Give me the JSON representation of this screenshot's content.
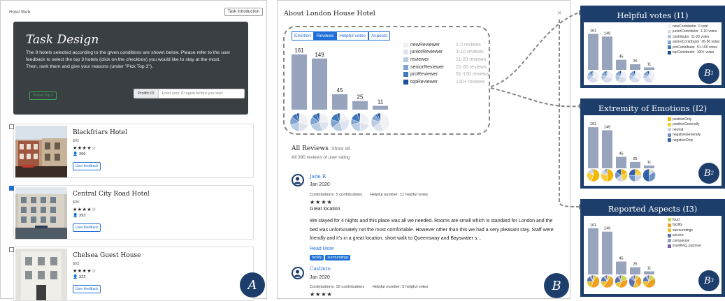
{
  "panel_a": {
    "brand": "Hotel Web",
    "task_intro_button": "Task Introduction",
    "task_title": "Task Design",
    "task_text_1": "The 9 hotels selected according to the given conditions are shown below. Please refer to the user feedback to select the top 3 hotels (click on the checkbox) you would like to stay at the most.",
    "task_text_2": "Then, rank them and give your reasons (under \"Pick Top 3\").",
    "picked_button": "Picked Top 3",
    "prolific_label": "Prolific ID",
    "prolific_placeholder": "Enter your ID again before you start",
    "hotels": [
      {
        "name": "Blackfriars Hotel",
        "price": "$92",
        "stars": "★★★★☆",
        "reviews": "396",
        "feedback": "User feedback",
        "checked": false
      },
      {
        "name": "Central City Road Hotel",
        "price": "$96",
        "stars": "★★★★☆",
        "reviews": "393",
        "feedback": "User feedback",
        "checked": true
      },
      {
        "name": "Chelsea Guest House",
        "price": "$93",
        "stars": "★★★★☆",
        "reviews": "322",
        "feedback": "User feedback",
        "checked": false
      }
    ],
    "badge": "A"
  },
  "panel_b": {
    "title": "About London House Hotel",
    "close": "×",
    "tabs": [
      "Emotion",
      "Reviews",
      "Helpful votes",
      "Aspects"
    ],
    "active_tab": 1,
    "legend": [
      {
        "name": "newReviewer",
        "range": "1-2 reviews",
        "color": "#f0f1f7"
      },
      {
        "name": "juniorReviewer",
        "range": "3-10 reviews",
        "color": "#dfe3ee"
      },
      {
        "name": "reviewer",
        "range": "11-20 reviews",
        "color": "#b9cbe3"
      },
      {
        "name": "seniorReviewer",
        "range": "21-50 reviews",
        "color": "#7ea4cf"
      },
      {
        "name": "proReviewer",
        "range": "51-100 reviews",
        "color": "#3f78bb"
      },
      {
        "name": "topReviewer",
        "range": "100+ reviews",
        "color": "#1a4f99"
      }
    ],
    "all_reviews_title": "All Reviews",
    "show_all": "Show all",
    "all_reviews_sub": "All 390 reviews of user rating",
    "reviews": [
      {
        "name": "Jade R",
        "date": "Jan 2020",
        "contributions": "Contributions: 5 contributions",
        "helpful": "Helpful number: 11 helpful votes",
        "stars": "★★★★",
        "headline": "Great location",
        "body": "We stayed for 4 nights and this place was all we needed. Rooms are small which is standard for London and the bed was unfortunately not the most comfortable. However other than this we had a very pleasant stay. Staff were friendly and it's in a great location, short walk to Queensway and Bayswater s...",
        "read_more": "Read More",
        "tags": [
          "facility",
          "surroundings"
        ]
      },
      {
        "name": "Castinto",
        "date": "Jan 2020",
        "contributions": "Contributions: 16 contributions",
        "helpful": "Helpful number: 5 helpful votes",
        "stars": "★★★★"
      }
    ],
    "badge": "B"
  },
  "panel_b1": {
    "title": "Helpful votes (I1)",
    "legend": [
      {
        "name": "newContributor",
        "range": "0 vote",
        "color": "#eef0f6"
      },
      {
        "name": "juniorContributor",
        "range": "1-10 votes",
        "color": "#d6dcea"
      },
      {
        "name": "contributor",
        "range": "11-25 votes",
        "color": "#b0c4e0"
      },
      {
        "name": "seniorContributor",
        "range": "26-50 votes",
        "color": "#7ea4cf"
      },
      {
        "name": "proContributor",
        "range": "51-100 votes",
        "color": "#3f78bb"
      },
      {
        "name": "topContributor",
        "range": "100+ votes",
        "color": "#1a4f99"
      }
    ],
    "badge": "B",
    "badge_sub": "1"
  },
  "panel_b2": {
    "title": "Extremity of Emotions (I2)",
    "legend": [
      {
        "name": "positiveOnly",
        "color": "#f2b705"
      },
      {
        "name": "positiveGenerally",
        "color": "#f5cf3a"
      },
      {
        "name": "neutral",
        "color": "#c9d3e3"
      },
      {
        "name": "negativeGenerally",
        "color": "#6f93c7"
      },
      {
        "name": "negativeOnly",
        "color": "#2f5fa8"
      }
    ],
    "badge": "B",
    "badge_sub": "2"
  },
  "panel_b3": {
    "title": "Reported Aspects (I3)",
    "legend": [
      {
        "name": "food",
        "color": "#c5d84a"
      },
      {
        "name": "facility",
        "color": "#f0a020"
      },
      {
        "name": "surroundings",
        "color": "#e8c330"
      },
      {
        "name": "service",
        "color": "#5c6fb0"
      },
      {
        "name": "companion",
        "color": "#8ea0cc"
      },
      {
        "name": "travelling_purpose",
        "color": "#7c5db0"
      }
    ],
    "badge": "B",
    "badge_sub": "3"
  },
  "chart_data": [
    {
      "type": "bar",
      "name": "reviews",
      "categories": [
        "1",
        "2",
        "3",
        "4",
        "5"
      ],
      "values": [
        161,
        149,
        45,
        25,
        11
      ],
      "ylim": [
        0,
        175
      ],
      "pie_fractions": [
        [
          0.3,
          0.2,
          0.2,
          0.15,
          0.1,
          0.05
        ],
        [
          0.25,
          0.2,
          0.25,
          0.15,
          0.1,
          0.05
        ],
        [
          0.2,
          0.25,
          0.2,
          0.15,
          0.15,
          0.05
        ],
        [
          0.3,
          0.2,
          0.2,
          0.1,
          0.15,
          0.05
        ],
        [
          0.45,
          0.2,
          0.15,
          0.1,
          0.05,
          0.05
        ]
      ]
    },
    {
      "type": "bar",
      "name": "helpful_votes",
      "categories": [
        "1",
        "2",
        "3",
        "4",
        "5"
      ],
      "values": [
        161,
        149,
        45,
        25,
        11
      ],
      "ylim": [
        0,
        175
      ],
      "pie_fractions": [
        [
          0.35,
          0.3,
          0.15,
          0.1,
          0.07,
          0.03
        ],
        [
          0.3,
          0.35,
          0.15,
          0.1,
          0.07,
          0.03
        ],
        [
          0.3,
          0.3,
          0.2,
          0.1,
          0.05,
          0.05
        ],
        [
          0.35,
          0.3,
          0.15,
          0.1,
          0.05,
          0.05
        ],
        [
          0.4,
          0.3,
          0.1,
          0.1,
          0.05,
          0.05
        ]
      ]
    },
    {
      "type": "bar",
      "name": "emotions",
      "categories": [
        "1",
        "2",
        "3",
        "4",
        "5"
      ],
      "values": [
        161,
        149,
        45,
        25,
        11
      ],
      "ylim": [
        0,
        175
      ],
      "pie_fractions": [
        [
          0.55,
          0.3,
          0.1,
          0.03,
          0.02
        ],
        [
          0.5,
          0.3,
          0.12,
          0.05,
          0.03
        ],
        [
          0.2,
          0.25,
          0.2,
          0.2,
          0.15
        ],
        [
          0.1,
          0.15,
          0.25,
          0.25,
          0.25
        ],
        [
          0.0,
          0.05,
          0.1,
          0.35,
          0.5
        ]
      ]
    },
    {
      "type": "bar",
      "name": "aspects",
      "categories": [
        "1",
        "2",
        "3",
        "4",
        "5"
      ],
      "values": [
        161,
        149,
        45,
        25,
        11
      ],
      "ylim": [
        0,
        175
      ],
      "pie_fractions": [
        [
          0.1,
          0.45,
          0.2,
          0.15,
          0.05,
          0.05
        ],
        [
          0.1,
          0.5,
          0.15,
          0.15,
          0.05,
          0.05
        ],
        [
          0.2,
          0.35,
          0.15,
          0.2,
          0.05,
          0.05
        ],
        [
          0.1,
          0.3,
          0.15,
          0.3,
          0.1,
          0.05
        ],
        [
          0.15,
          0.45,
          0.15,
          0.15,
          0.05,
          0.05
        ]
      ]
    }
  ]
}
